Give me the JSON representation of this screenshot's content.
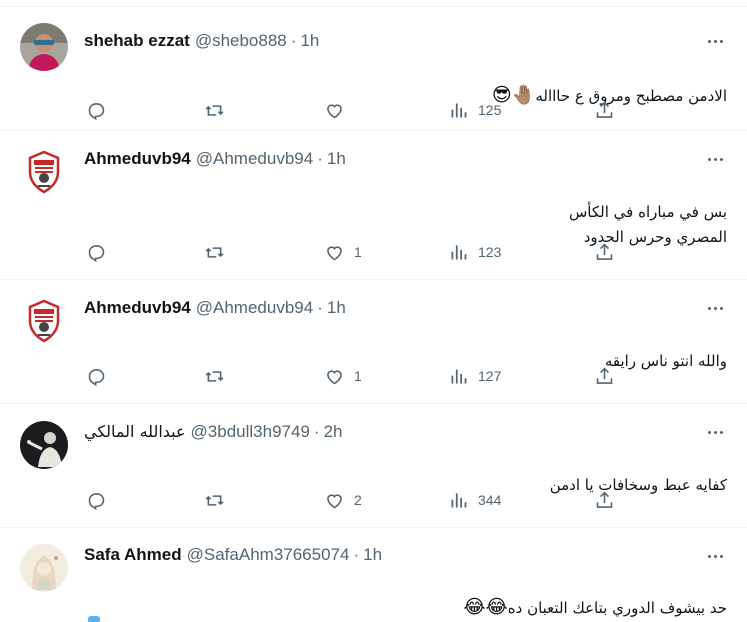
{
  "accent_color": "#1d9bf0",
  "muted_color": "#536471",
  "tweets": [
    {
      "name": "shehab ezzat",
      "handle": "@shebo888",
      "time": "1h",
      "text": "الادمن مصطبح ومروق ع حاااله",
      "emoji": "🤚🏽😎",
      "replies": "",
      "retweets": "",
      "likes": "",
      "views": "125",
      "avatar": "person-with-sunglasses"
    },
    {
      "name": "Ahmeduvb94",
      "handle": "@Ahmeduvb94",
      "time": "1h",
      "text": "بس في مباراه في الكأس\nالمصري وحرس الحدود",
      "emoji": "",
      "replies": "",
      "retweets": "",
      "likes": "1",
      "views": "123",
      "avatar": "zamalek-crest"
    },
    {
      "name": "Ahmeduvb94",
      "handle": "@Ahmeduvb94",
      "time": "1h",
      "text": "والله انتو ناس رايقه",
      "emoji": "",
      "replies": "",
      "retweets": "",
      "likes": "1",
      "views": "127",
      "avatar": "zamalek-crest"
    },
    {
      "name": "عبدالله المالكي",
      "handle": "@3bdull3h9749",
      "time": "2h",
      "text": "كفايه عبط وسخافات يا ادمن",
      "emoji": "",
      "replies": "",
      "retweets": "",
      "likes": "2",
      "views": "344",
      "avatar": "dark-photo-person"
    },
    {
      "name": "Safa Ahmed",
      "handle": "@SafaAhm37665074",
      "time": "1h",
      "text": "حد بيشوف الدوري بتاعك التعبان ده",
      "emoji": "😂😂",
      "replies": "",
      "retweets": "",
      "likes": "",
      "views": "",
      "avatar": "illustrated-woman-hijab"
    }
  ],
  "icons": {
    "reply": "reply-icon",
    "retweet": "retweet-icon",
    "like": "like-icon",
    "views": "views-icon",
    "share": "share-icon",
    "more": "more-icon"
  }
}
